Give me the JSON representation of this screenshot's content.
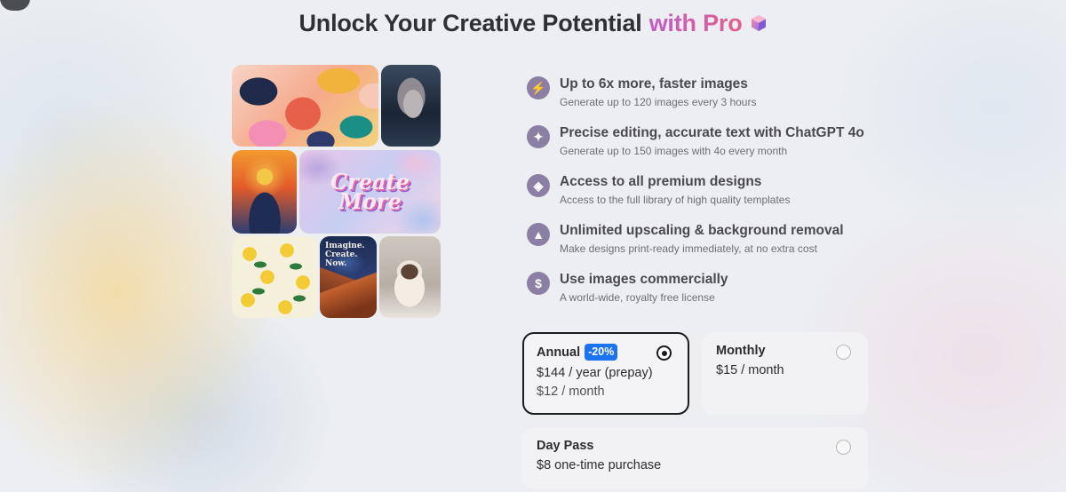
{
  "page": {
    "title_main": "Unlock Your Creative Potential",
    "title_accent": "with Pro"
  },
  "colors": {
    "accent_gradient_start": "#c15cc9",
    "accent_gradient_end": "#e0608a",
    "badge_blue": "#1c73f0",
    "feature_icon_bg": "#8b7fa3"
  },
  "collage": {
    "tile_create_more_line1": "Create",
    "tile_create_more_line2": "More",
    "tile_poster_line1": "Imagine.",
    "tile_poster_line2": "Create.",
    "tile_poster_line3": "Now."
  },
  "features": [
    {
      "icon": "lightning-icon",
      "glyph": "⚡",
      "title": "Up to 6x more, faster images",
      "desc": "Generate up to 120 images every 3 hours"
    },
    {
      "icon": "sparkle-icon",
      "glyph": "✦",
      "title": "Precise editing, accurate text with ChatGPT 4o",
      "desc": "Generate up to 150 images with 4o every month"
    },
    {
      "icon": "cube-icon",
      "glyph": "◈",
      "title": "Access to all premium designs",
      "desc": "Access to the full library of high quality templates"
    },
    {
      "icon": "image-icon",
      "glyph": "▲",
      "title": "Unlimited upscaling & background removal",
      "desc": "Make designs print-ready immediately, at no extra cost"
    },
    {
      "icon": "dollar-icon",
      "glyph": "$",
      "title": "Use images commercially",
      "desc": "A world-wide, royalty free license"
    }
  ],
  "plans": {
    "annual": {
      "name": "Annual",
      "badge": "-20%",
      "price": "$144 / year (prepay)",
      "sub": "$12 / month",
      "selected": true
    },
    "monthly": {
      "name": "Monthly",
      "price": "$15 / month",
      "selected": false
    },
    "day_pass": {
      "name": "Day Pass",
      "price": "$8 one-time purchase",
      "selected": false
    }
  }
}
